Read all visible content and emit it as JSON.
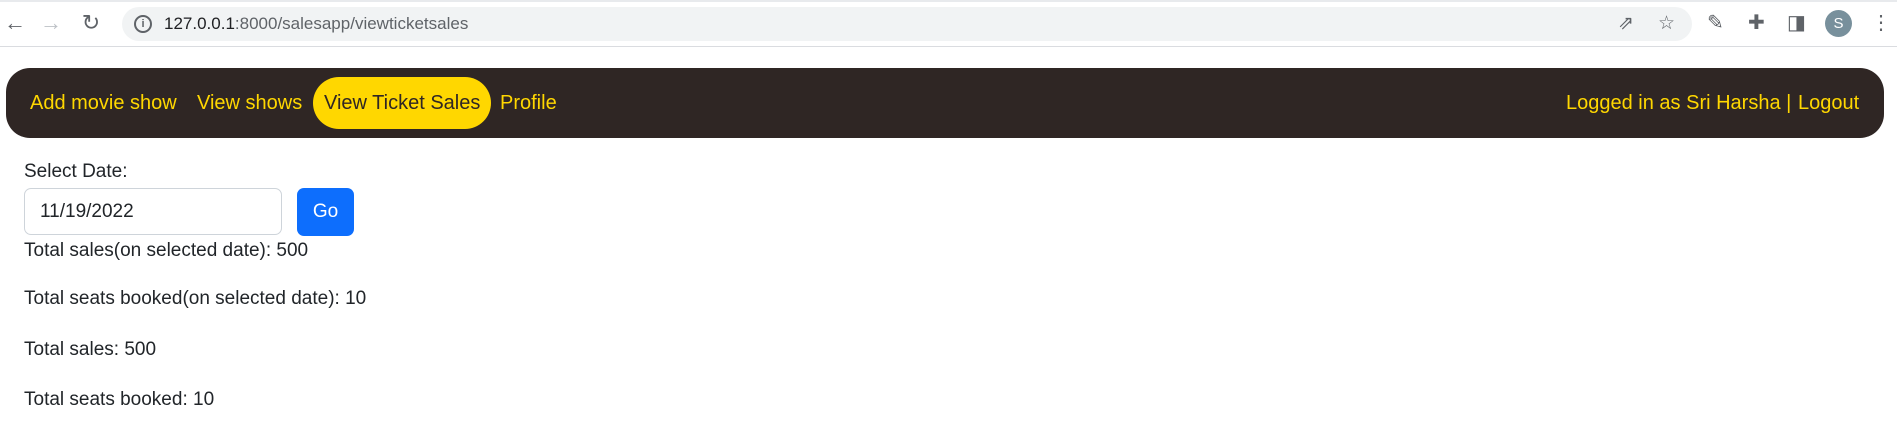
{
  "browser": {
    "url_host": "127.0.0.1",
    "url_rest": ":8000/salesapp/viewticketsales",
    "profile_initial": "S"
  },
  "nav": {
    "links": [
      "Add movie show",
      "View shows",
      "View Ticket Sales",
      "Profile"
    ],
    "logged_in": "Logged in as Sri Harsha |",
    "logout": "Logout",
    "accent_color": "#ffd700",
    "bg_color": "#2f2624"
  },
  "form": {
    "label": "Select Date:",
    "date_value": "11/19/2022",
    "go_label": "Go"
  },
  "stats": [
    "Total sales(on selected date): 500",
    "Total seats booked(on selected date): 10",
    "Total sales: 500",
    "Total seats booked: 10"
  ]
}
